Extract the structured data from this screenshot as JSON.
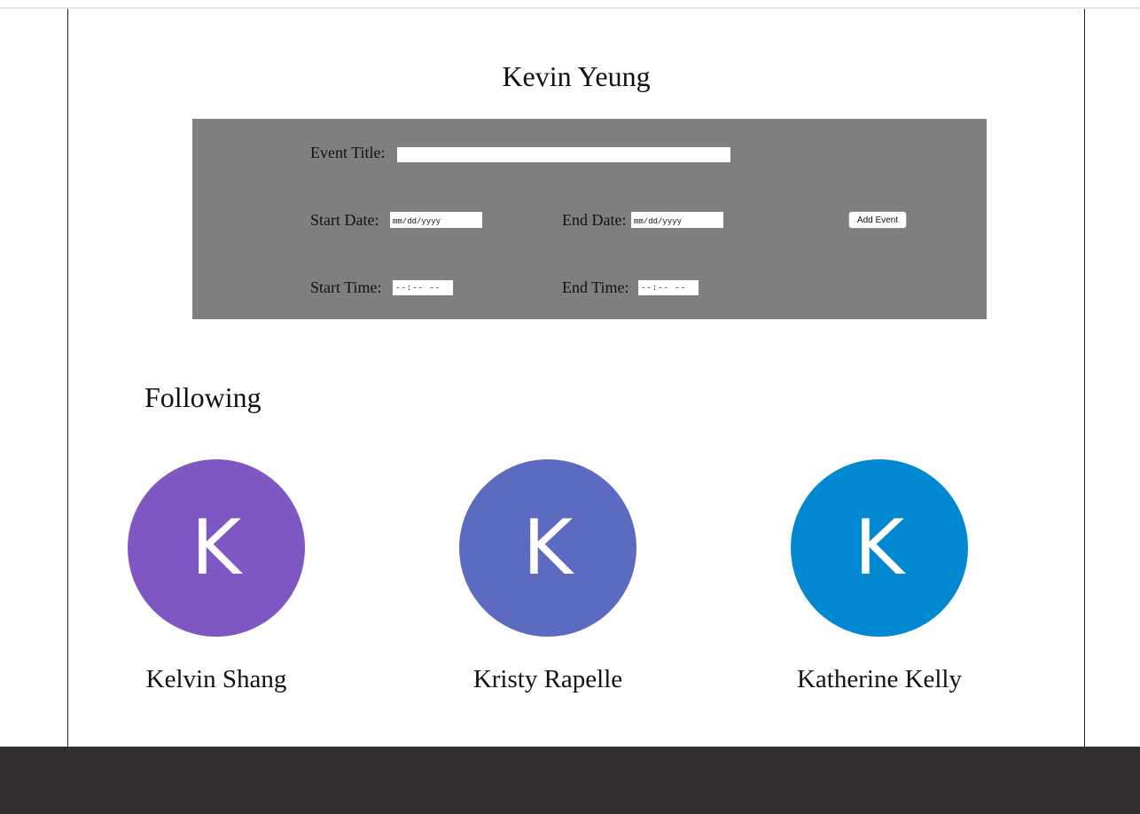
{
  "profile": {
    "name": "Kevin Yeung"
  },
  "event_form": {
    "title_label": "Event Title:",
    "title_value": "",
    "start_date_label": "Start Date:",
    "start_date_placeholder": "mm/dd/yyyy",
    "end_date_label": "End Date:",
    "end_date_placeholder": "mm/dd/yyyy",
    "start_time_label": "Start Time:",
    "start_time_placeholder": "--:-- --",
    "end_time_label": "End Time:",
    "end_time_placeholder": "--:-- --",
    "add_button_label": "Add Event",
    "panel_color": "#7f7f7f"
  },
  "following": {
    "heading": "Following",
    "people": [
      {
        "name": "Kelvin Shang",
        "initial": "K",
        "avatar_color": "#7e57c2"
      },
      {
        "name": "Kristy Rapelle",
        "initial": "K",
        "avatar_color": "#5c6bc0"
      },
      {
        "name": "Katherine Kelly",
        "initial": "K",
        "avatar_color": "#0288d1"
      }
    ]
  },
  "footer": {
    "color": "#322e2f"
  }
}
